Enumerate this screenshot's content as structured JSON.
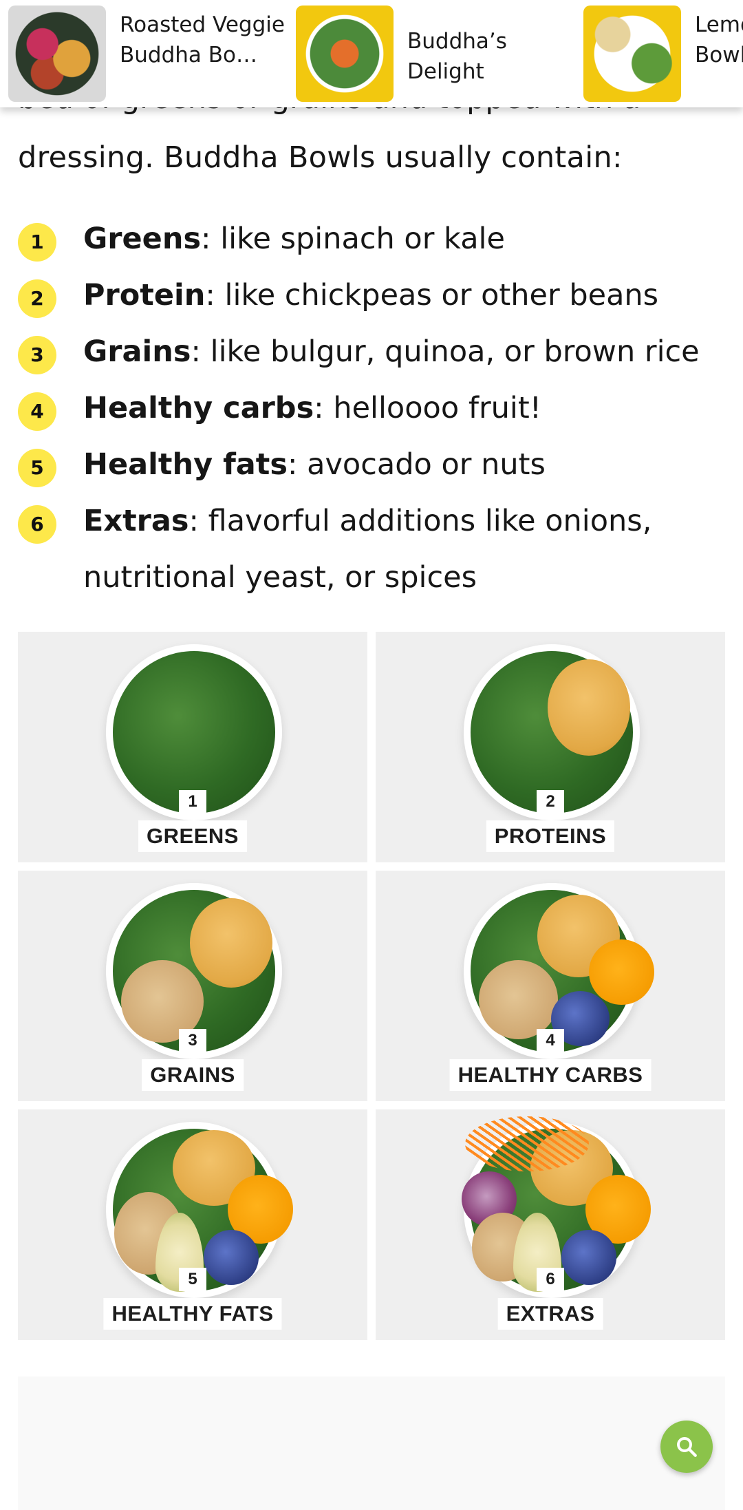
{
  "recommendations": [
    {
      "title": "Roasted Veggie Buddha Bo…"
    },
    {
      "title": "Buddha’s Delight"
    },
    {
      "title": "Lemon Arugula Bowl"
    }
  ],
  "article": {
    "partial_line": "bed of greens or grains and topped with a",
    "intro": "dressing. Buddha Bowls usually contain:",
    "steps": [
      {
        "num": "1",
        "term": "Greens",
        "desc": ": like spinach or kale"
      },
      {
        "num": "2",
        "term": "Protein",
        "desc": ": like chickpeas or other beans"
      },
      {
        "num": "3",
        "term": "Grains",
        "desc": ": like bulgur, quinoa, or brown rice"
      },
      {
        "num": "4",
        "term": "Healthy carbs",
        "desc": ": helloooo fruit!"
      },
      {
        "num": "5",
        "term": "Healthy fats",
        "desc": ": avocado or nuts"
      },
      {
        "num": "6",
        "term": "Extras",
        "desc": ": flavorful additions like onions, nutritional yeast, or spices"
      }
    ]
  },
  "image_grid": [
    {
      "num": "1",
      "label": "GREENS"
    },
    {
      "num": "2",
      "label": "PROTEINS"
    },
    {
      "num": "3",
      "label": "GRAINS"
    },
    {
      "num": "4",
      "label": "HEALTHY CARBS"
    },
    {
      "num": "5",
      "label": "HEALTHY FATS"
    },
    {
      "num": "6",
      "label": "EXTRAS"
    }
  ],
  "fab": {
    "icon": "search-icon",
    "color": "#8bc34a"
  },
  "colors": {
    "step_badge": "#fde84a",
    "tile_bg": "#efefef"
  }
}
